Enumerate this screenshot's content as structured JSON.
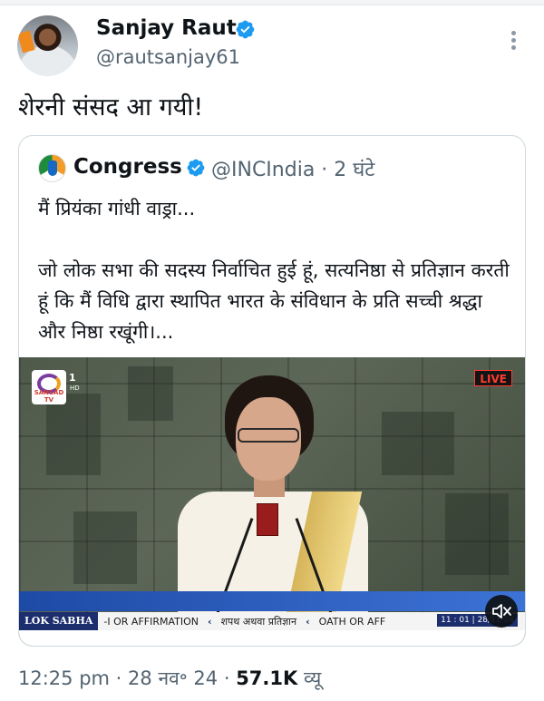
{
  "tweet": {
    "author_name": "Sanjay Raut",
    "handle": "@rautsanjay61",
    "text": "शेरनी संसद आ गयी!",
    "meta": {
      "time": "12:25 pm",
      "separator": "·",
      "date": "28 नव॰ 24",
      "views_count": "57.1K",
      "views_label": "व्यू"
    }
  },
  "quoted_tweet": {
    "author_name": "Congress",
    "handle_time": "@INCIndia · 2 घंटे",
    "line1": "मैं प्रियंका गांधी वाड्रा...",
    "body": "जो लोक सभा की सदस्य निर्वाचित हुई हूं, सत्यनिष्ठा से प्रतिज्ञान करती हूं कि मैं विधि द्वारा स्थापित भारत के संविधान के प्रति सच्ची श्रद्धा और निष्ठा रखूंगी।...",
    "video": {
      "channel_logo_text": "SANSAD TV",
      "channel_number": "1",
      "channel_hd": "HD",
      "live_badge": "LIVE",
      "ticker_label": "LOK SABHA",
      "ticker_seg1": "-I OR AFFIRMATION",
      "ticker_seg2": "शपथ अथवा प्रतिज्ञान",
      "ticker_seg3": "OATH OR AFF",
      "ticker_arrow": "‹",
      "ticker_time": "11 : 01 | 28/11/24"
    }
  },
  "icons": {
    "verified": "verified-badge-icon",
    "more": "more-options-icon",
    "mute": "mute-icon"
  },
  "colors": {
    "verified_blue": "#1d9bf0",
    "text_primary": "#0f1419",
    "text_secondary": "#536471",
    "card_border": "#cfd9de"
  }
}
